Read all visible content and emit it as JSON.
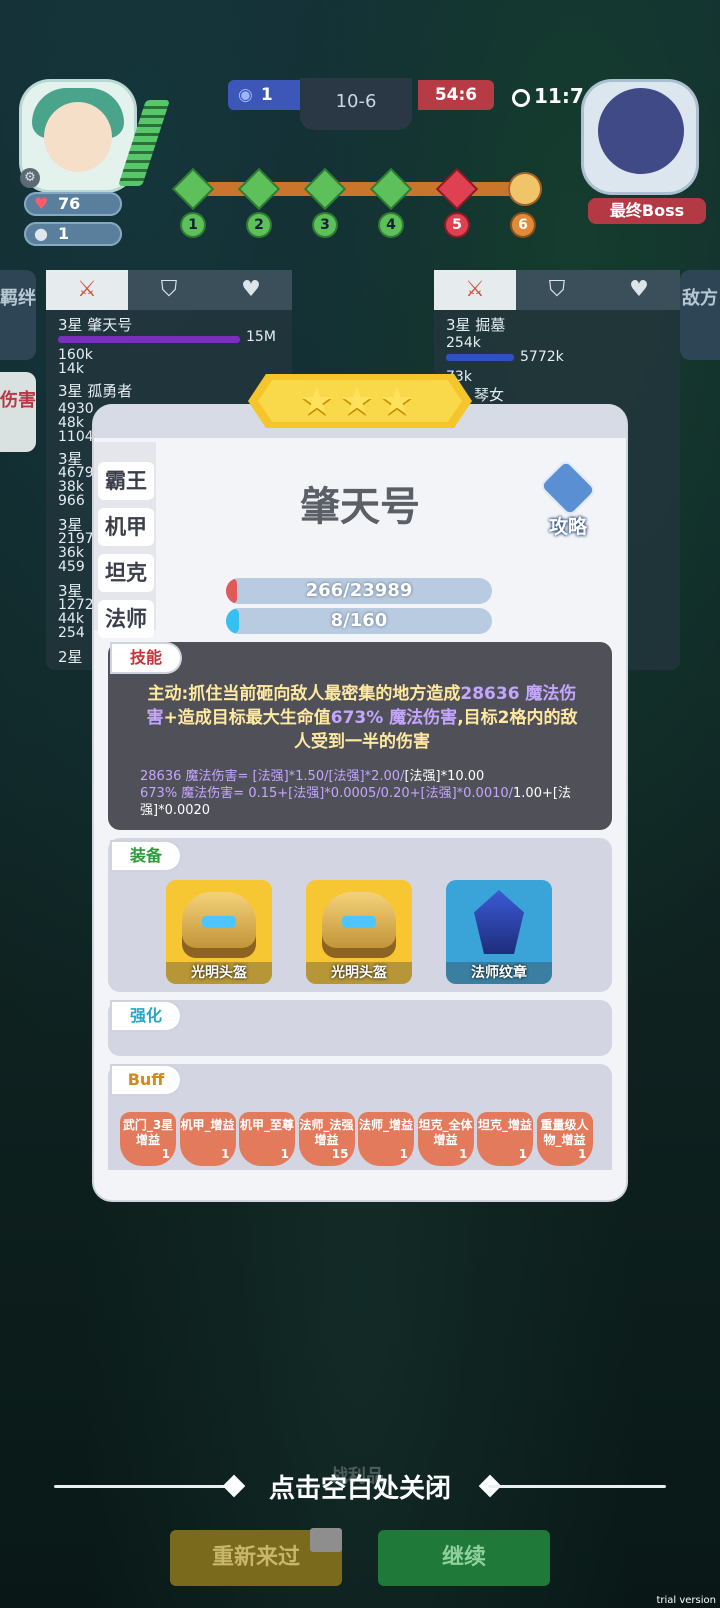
{
  "hud": {
    "lives": "76",
    "coins": "1",
    "blue_score": "1",
    "round": "10-6",
    "red_score": "54:6",
    "timer": "11:7",
    "boss_label": "最终Boss",
    "stages": [
      "1",
      "2",
      "3",
      "4",
      "5",
      "6"
    ],
    "current_stage_index": 5
  },
  "side_tabs": {
    "left_top": "羁绊",
    "left_active": "伤害",
    "right": "敌方"
  },
  "left_panel": {
    "rows": [
      {
        "name": "3星 肇天号",
        "value": "15M",
        "sub": [
          "160k",
          "14k"
        ]
      },
      {
        "name": "3星 孤勇者",
        "sub": [
          "4930",
          "48k",
          "1104"
        ]
      },
      {
        "name": "3星",
        "sub": [
          "4679",
          "38k",
          "966"
        ]
      },
      {
        "name": "3星",
        "sub": [
          "2197",
          "36k",
          "459"
        ]
      },
      {
        "name": "3星",
        "sub": [
          "1272",
          "44k",
          "254"
        ]
      },
      {
        "name": "2星",
        "sub": []
      }
    ]
  },
  "right_panel": {
    "rows": [
      {
        "name": "3星 掘墓",
        "value": "5772k",
        "sub": [
          "254k",
          "73k"
        ]
      },
      {
        "name": "琴女",
        "sub": []
      }
    ]
  },
  "modal": {
    "stars": "★★★",
    "classes": [
      "霸王",
      "机甲",
      "坦克",
      "法师"
    ],
    "hero_name": "肇天号",
    "strategy_label": "攻略",
    "hp": {
      "current": 266,
      "max": 23989,
      "text": "266/23989"
    },
    "mana": {
      "current": 8,
      "max": 160,
      "text": "8/160"
    },
    "skill": {
      "tag": "技能",
      "desc_a": "主动:抓住当前砸向敌人最密集的地方造成",
      "desc_b": "28636 魔法伤害",
      "desc_c": "+造成目标最大生命值",
      "desc_d": "673% 魔法伤害",
      "desc_e": ",目标2格内的敌人受到一半的伤害",
      "formula1_a": "28636 魔法伤害= [法强]*1.50/[法强]*2.00/",
      "formula1_b": "[法强]*10.00",
      "formula2_a": "673% 魔法伤害= 0.15+[法强]*0.0005/0.20+[法强]*0.0010/",
      "formula2_b": "1.00+[法强]*0.0020"
    },
    "equipment": {
      "tag": "装备",
      "items": [
        {
          "label": "光明头盔",
          "color": "#f7c633",
          "icon": "helmet-icon"
        },
        {
          "label": "光明头盔",
          "color": "#f7c633",
          "icon": "helmet-icon"
        },
        {
          "label": "法师纹章",
          "color": "#3aa3d8",
          "icon": "emblem-icon"
        }
      ]
    },
    "strengthen": {
      "tag": "强化"
    },
    "buffs": {
      "tag": "Buff",
      "items": [
        {
          "label": "武门_3星增益",
          "count": "1"
        },
        {
          "label": "机甲_增益",
          "count": "1"
        },
        {
          "label": "机甲_至尊",
          "count": "1"
        },
        {
          "label": "法师_法强增益",
          "count": "15"
        },
        {
          "label": "法师_增益",
          "count": "1"
        },
        {
          "label": "坦克_全体增益",
          "count": "1"
        },
        {
          "label": "坦克_增益",
          "count": "1"
        },
        {
          "label": "重量级人物_增益",
          "count": "1"
        }
      ]
    }
  },
  "close_hint": "点击空白处关闭",
  "behind_text": "战利品",
  "buttons": {
    "retry": "重新来过",
    "continue": "继续"
  },
  "watermark": "trial version",
  "colors": {
    "accent_red": "#b93845",
    "hp_fill": "#e05a5a",
    "mana_fill": "#35c1f0",
    "retry_bg": "#7a6a1c",
    "continue_bg": "#1f7a3a"
  }
}
